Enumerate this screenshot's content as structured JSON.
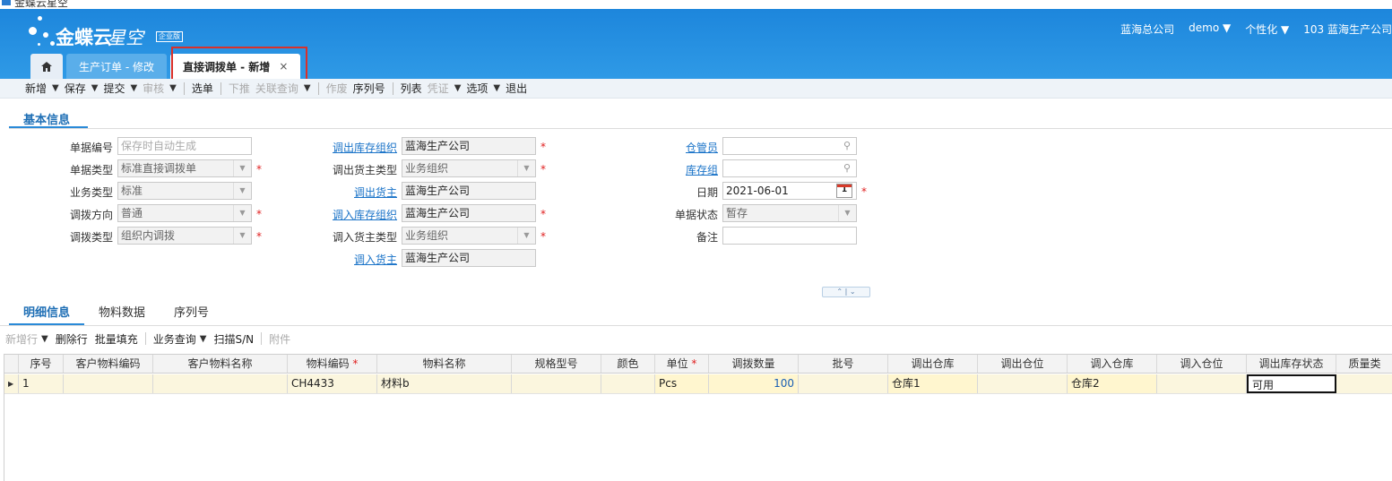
{
  "window": {
    "title": "金蝶云星空"
  },
  "brand": {
    "name": "金蝶云",
    "product": "星空",
    "edition": "企业版"
  },
  "topnav": {
    "company": "蓝海总公司",
    "user": "demo ▼",
    "personalize": "个性化 ▼",
    "org": "103  蓝海生产公司"
  },
  "tabs": [
    {
      "label": "生产订单 - 修改"
    },
    {
      "label": "直接调拨单 - 新增",
      "close": "×"
    }
  ],
  "toolbar": {
    "new": "新增",
    "save": "保存",
    "submit": "提交",
    "audit": "审核",
    "select_bill": "选单",
    "push": "下推",
    "linked_query": "关联查询",
    "void": "作废",
    "serial": "序列号",
    "list": "列表",
    "voucher": "凭证",
    "options": "选项",
    "exit": "退出",
    "arrow": "▼"
  },
  "section": {
    "basic_info": "基本信息"
  },
  "form": {
    "bill_no": {
      "label": "单据编号",
      "placeholder": "保存时自动生成"
    },
    "bill_type": {
      "label": "单据类型",
      "value": "标准直接调拨单"
    },
    "biz_type": {
      "label": "业务类型",
      "value": "标准"
    },
    "transfer_dir": {
      "label": "调拨方向",
      "value": "普通"
    },
    "transfer_type": {
      "label": "调拨类型",
      "value": "组织内调拨"
    },
    "out_stock_org": {
      "label": "调出库存组织",
      "value": "蓝海生产公司"
    },
    "out_owner_type": {
      "label": "调出货主类型",
      "value": "业务组织"
    },
    "out_owner": {
      "label": "调出货主",
      "value": "蓝海生产公司"
    },
    "in_stock_org": {
      "label": "调入库存组织",
      "value": "蓝海生产公司"
    },
    "in_owner_type": {
      "label": "调入货主类型",
      "value": "业务组织"
    },
    "in_owner": {
      "label": "调入货主",
      "value": "蓝海生产公司"
    },
    "stock_keeper": {
      "label": "仓管员",
      "value": ""
    },
    "stock_group": {
      "label": "库存组",
      "value": ""
    },
    "date": {
      "label": "日期",
      "value": "2021-06-01",
      "cal_day": "1"
    },
    "bill_status": {
      "label": "单据状态",
      "value": "暂存"
    },
    "remark": {
      "label": "备注",
      "value": ""
    },
    "required_mark": "*"
  },
  "collapse": {
    "label": "⌃ | ⌄"
  },
  "detail_tabs": [
    {
      "label": "明细信息"
    },
    {
      "label": "物料数据"
    },
    {
      "label": "序列号"
    }
  ],
  "toolbar2": {
    "add_row": "新增行",
    "delete_row": "删除行",
    "batch_fill": "批量填充",
    "biz_query": "业务查询",
    "scan_sn": "扫描S/N",
    "attachment": "附件",
    "arrow": "▼"
  },
  "grid": {
    "columns": [
      "序号",
      "客户物料编码",
      "客户物料名称",
      "物料编码",
      "物料名称",
      "规格型号",
      "颜色",
      "单位",
      "调拨数量",
      "批号",
      "调出仓库",
      "调出仓位",
      "调入仓库",
      "调入仓位",
      "调出库存状态",
      "质量类"
    ],
    "required": "*",
    "row_indicator": "▶",
    "rows": [
      {
        "seq": "1",
        "cust_mat_code": "",
        "cust_mat_name": "",
        "mat_code": "CH4433",
        "mat_name": "材料b",
        "spec": "",
        "color": "",
        "unit": "Pcs",
        "qty": "100",
        "lot": "",
        "out_wh": "仓库1",
        "out_loc": "",
        "in_wh": "仓库2",
        "in_loc": "",
        "out_status": "可用",
        "quality": ""
      }
    ]
  },
  "colors": {
    "header": "#1d86dc",
    "link": "#1a73c8",
    "required": "#e02020",
    "highlight_box": "#d9302a"
  }
}
